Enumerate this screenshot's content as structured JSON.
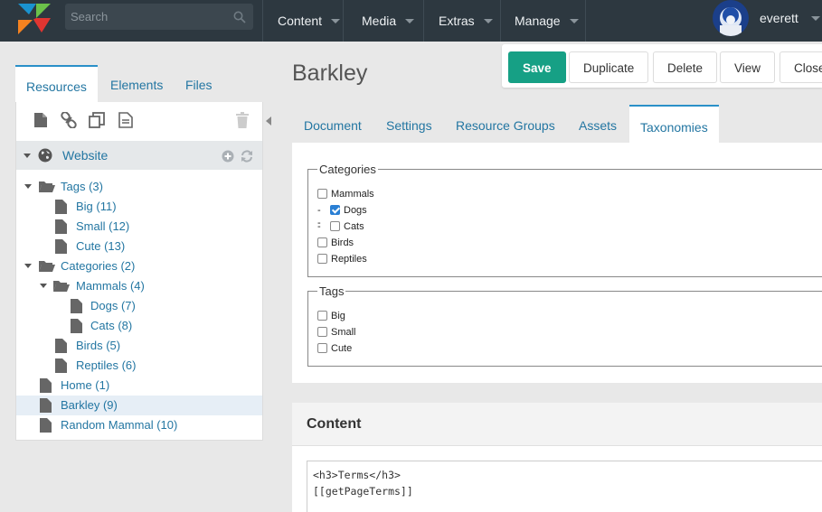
{
  "topbar": {
    "search_placeholder": "Search",
    "nav": [
      "Content",
      "Media",
      "Extras",
      "Manage"
    ],
    "username": "everett",
    "icons": [
      "modx-logo-icon",
      "search-icon",
      "chevron-down-icon",
      "avatar"
    ]
  },
  "left": {
    "tabs": [
      "Resources",
      "Elements",
      "Files"
    ],
    "website_label": "Website",
    "tree": [
      {
        "label": "Tags (3)",
        "type": "folder",
        "expanded": true
      },
      {
        "label": "Big (11)",
        "type": "doc"
      },
      {
        "label": "Small (12)",
        "type": "doc"
      },
      {
        "label": "Cute (13)",
        "type": "doc"
      },
      {
        "label": "Categories (2)",
        "type": "folder",
        "expanded": true
      },
      {
        "label": "Mammals (4)",
        "type": "folder",
        "expanded": true
      },
      {
        "label": "Dogs (7)",
        "type": "doc"
      },
      {
        "label": "Cats (8)",
        "type": "doc"
      },
      {
        "label": "Birds (5)",
        "type": "doc"
      },
      {
        "label": "Reptiles (6)",
        "type": "doc"
      },
      {
        "label": "Home (1)",
        "type": "doc"
      },
      {
        "label": "Barkley (9)",
        "type": "doc",
        "selected": true
      },
      {
        "label": "Random Mammal (10)",
        "type": "doc"
      }
    ]
  },
  "main": {
    "title": "Barkley",
    "buttons": {
      "save": "Save",
      "duplicate": "Duplicate",
      "delete": "Delete",
      "view": "View",
      "close": "Close"
    },
    "tabs": [
      "Document",
      "Settings",
      "Resource Groups",
      "Assets",
      "Taxonomies"
    ],
    "active_tab": "Taxonomies",
    "categories_legend": "Categories",
    "categories": [
      {
        "prefix": "",
        "label": "Mammals",
        "checked": false
      },
      {
        "prefix": "--",
        "label": "Dogs",
        "checked": true
      },
      {
        "prefix": "--",
        "label": "Cats",
        "checked": false
      },
      {
        "prefix": "",
        "label": "Birds",
        "checked": false
      },
      {
        "prefix": "",
        "label": "Reptiles",
        "checked": false
      }
    ],
    "tags_legend": "Tags",
    "tags": [
      {
        "label": "Big",
        "checked": false
      },
      {
        "label": "Small",
        "checked": false
      },
      {
        "label": "Cute",
        "checked": false
      }
    ],
    "content_heading": "Content",
    "content_code": "<h3>Terms</h3>\n[[getPageTerms]]"
  },
  "colors": {
    "topbar": "#2d3840",
    "primary": "#16a085",
    "link": "#2376a2",
    "accent": "#2a90c8"
  }
}
